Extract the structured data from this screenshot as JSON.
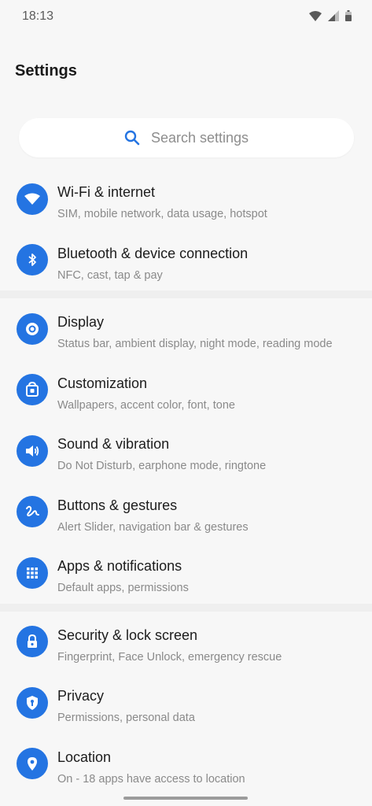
{
  "status": {
    "time": "18:13"
  },
  "page_title": "Settings",
  "search": {
    "placeholder": "Search settings"
  },
  "accent": "#2474e2",
  "items": [
    {
      "icon": "wifi-icon",
      "title": "Wi-Fi & internet",
      "subtitle": "SIM, mobile network, data usage, hotspot"
    },
    {
      "icon": "bluetooth-icon",
      "title": "Bluetooth & device connection",
      "subtitle": "NFC, cast, tap & pay"
    },
    {
      "icon": "display-icon",
      "title": "Display",
      "subtitle": "Status bar, ambient display, night mode, reading mode"
    },
    {
      "icon": "customization-icon",
      "title": "Customization",
      "subtitle": "Wallpapers, accent color, font, tone"
    },
    {
      "icon": "sound-icon",
      "title": "Sound & vibration",
      "subtitle": "Do Not Disturb, earphone mode, ringtone"
    },
    {
      "icon": "gesture-icon",
      "title": "Buttons & gestures",
      "subtitle": "Alert Slider, navigation bar & gestures"
    },
    {
      "icon": "apps-grid-icon",
      "title": "Apps & notifications",
      "subtitle": "Default apps, permissions"
    },
    {
      "icon": "lock-icon",
      "title": "Security & lock screen",
      "subtitle": "Fingerprint, Face Unlock, emergency rescue"
    },
    {
      "icon": "privacy-shield-icon",
      "title": "Privacy",
      "subtitle": "Permissions, personal data"
    },
    {
      "icon": "location-pin-icon",
      "title": "Location",
      "subtitle": "On - 18 apps have access to location"
    }
  ]
}
